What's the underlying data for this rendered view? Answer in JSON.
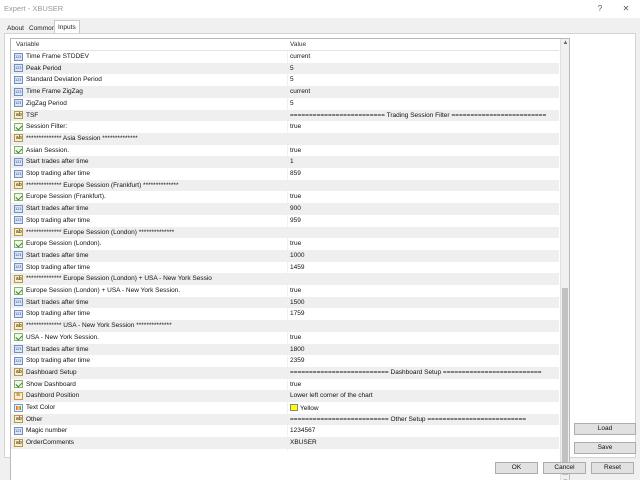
{
  "window": {
    "title": "Expert - XBUSER",
    "help_label": "?",
    "close_label": "✕"
  },
  "tabs": [
    {
      "label": "About",
      "active": false
    },
    {
      "label": "Common",
      "active": false
    },
    {
      "label": "Inputs",
      "active": true
    }
  ],
  "table": {
    "headers": {
      "variable": "Variable",
      "value": "Value"
    },
    "rows": [
      {
        "icon": "number-icon",
        "variable": "Time Frame STDDEV",
        "value": "current"
      },
      {
        "icon": "number-icon",
        "variable": "Peak Period",
        "value": "5"
      },
      {
        "icon": "number-icon",
        "variable": "Standard Deviation Period",
        "value": "5"
      },
      {
        "icon": "number-icon",
        "variable": "Time Frame ZigZag",
        "value": "current"
      },
      {
        "icon": "number-icon",
        "variable": "ZigZag Period",
        "value": "5"
      },
      {
        "icon": "text-icon",
        "variable": "TSF",
        "value": "=========================  Trading Session Filter  ========================="
      },
      {
        "icon": "boolean-icon",
        "variable": "Session Filter:",
        "value": "true"
      },
      {
        "icon": "text-icon",
        "variable": "**************  Asia Session  **************",
        "value": ""
      },
      {
        "icon": "boolean-icon",
        "variable": "Asian Session.",
        "value": "true"
      },
      {
        "icon": "number-icon",
        "variable": "Start trades after time",
        "value": "1"
      },
      {
        "icon": "number-icon",
        "variable": "Stop trading after time",
        "value": "859"
      },
      {
        "icon": "text-icon",
        "variable": "**************  Europe Session (Frankfurt) **************",
        "value": ""
      },
      {
        "icon": "boolean-icon",
        "variable": "Europe Session (Frankfurt).",
        "value": "true"
      },
      {
        "icon": "number-icon",
        "variable": "Start trades after time",
        "value": "900"
      },
      {
        "icon": "number-icon",
        "variable": "Stop trading after time",
        "value": "959"
      },
      {
        "icon": "text-icon",
        "variable": "**************  Europe Session (London) **************",
        "value": ""
      },
      {
        "icon": "boolean-icon",
        "variable": "Europe Session (London).",
        "value": "true"
      },
      {
        "icon": "number-icon",
        "variable": "Start trades after time",
        "value": "1000"
      },
      {
        "icon": "number-icon",
        "variable": "Stop trading after time",
        "value": "1459"
      },
      {
        "icon": "text-icon",
        "variable": "**************  Europe Session (London) + USA - New York Sessio",
        "value": ""
      },
      {
        "icon": "boolean-icon",
        "variable": "Europe Session (London) + USA - New York Session.",
        "value": "true"
      },
      {
        "icon": "number-icon",
        "variable": "Start trades after time",
        "value": "1500"
      },
      {
        "icon": "number-icon",
        "variable": "Stop trading after time",
        "value": "1759"
      },
      {
        "icon": "text-icon",
        "variable": "**************  USA - New York Session  **************",
        "value": ""
      },
      {
        "icon": "boolean-icon",
        "variable": "USA - New York Session.",
        "value": "true"
      },
      {
        "icon": "number-icon",
        "variable": "Start trades after time",
        "value": "1800"
      },
      {
        "icon": "number-icon",
        "variable": "Stop trading after time",
        "value": "2359"
      },
      {
        "icon": "text-icon",
        "variable": "Dashboard Setup",
        "value": "==========================  Dashboard Setup  =========================="
      },
      {
        "icon": "boolean-icon",
        "variable": "Show Dashboard",
        "value": "true"
      },
      {
        "icon": "list-icon",
        "variable": "Dashbord Position",
        "value": "Lower left corner of the chart"
      },
      {
        "icon": "color-icon",
        "variable": "Text Color",
        "value": "Yellow",
        "swatch": "#ffff00"
      },
      {
        "icon": "text-icon",
        "variable": "Other",
        "value": "==========================  Other Setup  =========================="
      },
      {
        "icon": "number-icon",
        "variable": "Magic number",
        "value": "1234567"
      },
      {
        "icon": "text-icon",
        "variable": "OrderComments",
        "value": "XBUSER"
      }
    ]
  },
  "scrollbar": {
    "up_label": "▲",
    "down_label": "▼"
  },
  "side_buttons": {
    "load_label": "Load",
    "save_label": "Save"
  },
  "buttons": {
    "ok_label": "OK",
    "cancel_label": "Cancel",
    "reset_label": "Reset"
  },
  "colors": {
    "alt_row": "#efefef",
    "yellow": "#ffff00"
  }
}
